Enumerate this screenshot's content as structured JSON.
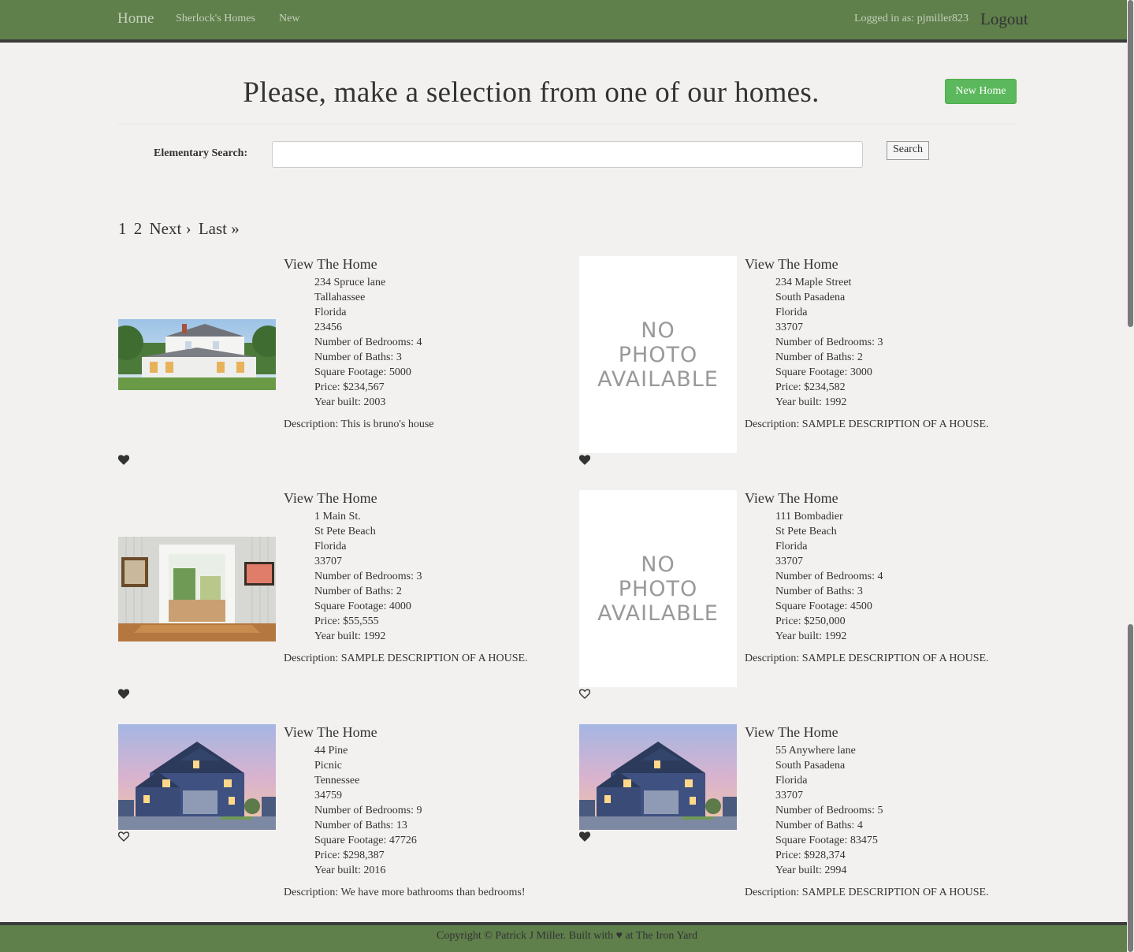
{
  "nav": {
    "home": "Home",
    "links": [
      "Sherlock's Homes",
      "New"
    ],
    "logged_in": "Logged in as: pjmiller823",
    "logout": "Logout"
  },
  "page": {
    "headline": "Please, make a selection from one of our homes.",
    "new_home_button": "New Home"
  },
  "search": {
    "label": "Elementary Search:",
    "value": "",
    "button": "Search"
  },
  "pagination": [
    "1",
    "2",
    "Next ›",
    "Last »"
  ],
  "listings": [
    {
      "link": "View The Home",
      "photo": "white-farmhouse",
      "lines": [
        "234 Spruce lane",
        "Tallahassee",
        "Florida",
        "23456",
        "Number of Bedrooms: 4",
        "Number of Baths: 3",
        "Square Footage: 5000",
        "Price: $234,567",
        "Year built: 2003"
      ],
      "description": "Description: This is bruno's house",
      "favorited": true
    },
    {
      "link": "View The Home",
      "photo": "no-photo",
      "no_photo_text": [
        "NO",
        "PHOTO",
        "AVAILABLE"
      ],
      "lines": [
        "234 Maple Street",
        "South Pasadena",
        "Florida",
        "33707",
        "Number of Bedrooms: 3",
        "Number of Baths: 2",
        "Square Footage: 3000",
        "Price: $234,582",
        "Year built: 1992"
      ],
      "description": "Description: SAMPLE DESCRIPTION OF A HOUSE.",
      "favorited": true
    },
    {
      "link": "View The Home",
      "photo": "interior-doorway",
      "lines": [
        "1 Main St.",
        "St Pete Beach",
        "Florida",
        "33707",
        "Number of Bedrooms: 3",
        "Number of Baths: 2",
        "Square Footage: 4000",
        "Price: $55,555",
        "Year built: 1992"
      ],
      "description": "Description: SAMPLE DESCRIPTION OF A HOUSE.",
      "favorited": true
    },
    {
      "link": "View The Home",
      "photo": "no-photo",
      "no_photo_text": [
        "NO",
        "PHOTO",
        "AVAILABLE"
      ],
      "lines": [
        "111 Bombadier",
        "St Pete Beach",
        "Florida",
        "33707",
        "Number of Bedrooms: 4",
        "Number of Baths: 3",
        "Square Footage: 4500",
        "Price: $250,000",
        "Year built: 1992"
      ],
      "description": "Description: SAMPLE DESCRIPTION OF A HOUSE.",
      "favorited": false
    },
    {
      "link": "View The Home",
      "photo": "blue-house-dusk",
      "lines": [
        "44 Pine",
        "Picnic",
        "Tennessee",
        "34759",
        "Number of Bedrooms: 9",
        "Number of Baths: 13",
        "Square Footage: 47726",
        "Price: $298,387",
        "Year built: 2016"
      ],
      "description": "Description: We have more bathrooms than bedrooms!",
      "favorited": false
    },
    {
      "link": "View The Home",
      "photo": "blue-house-dusk",
      "lines": [
        "55 Anywhere lane",
        "South Pasadena",
        "Florida",
        "33707",
        "Number of Bedrooms: 5",
        "Number of Baths: 4",
        "Square Footage: 83475",
        "Price: $928,374",
        "Year built: 2994"
      ],
      "description": "Description: SAMPLE DESCRIPTION OF A HOUSE.",
      "favorited": true
    }
  ],
  "footer": "Copyright © Patrick J Miller. Built with ♥ at The Iron Yard",
  "colors": {
    "navbar": "#5f7f4b",
    "nav_border": "#3b3b3b",
    "background": "#f2f1ef",
    "new_home_button": "#5cb85c"
  }
}
